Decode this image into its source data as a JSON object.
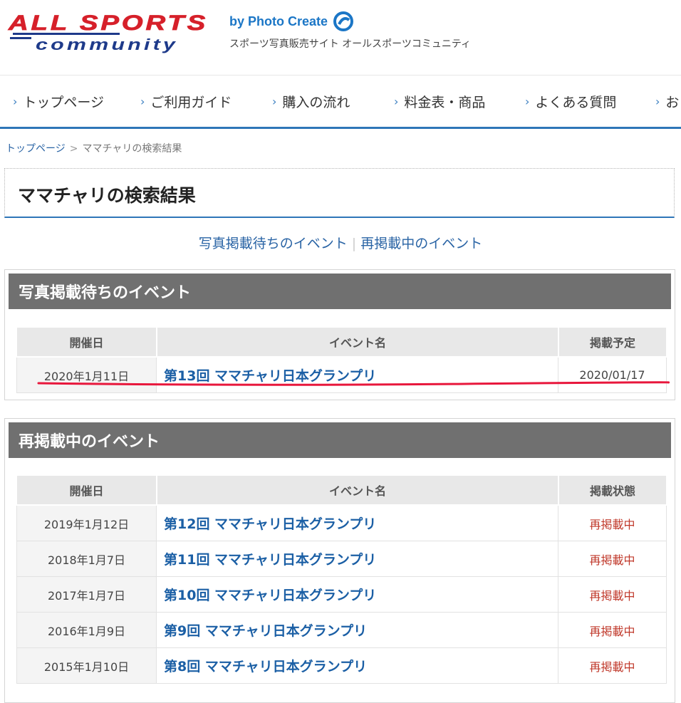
{
  "header": {
    "by_line": "by Photo Create",
    "tagline": "スポーツ写真販売サイト オールスポーツコミュニティ",
    "logo_lines": [
      "ALL SPORTS",
      "community"
    ]
  },
  "nav": {
    "items": [
      {
        "label": "トップページ"
      },
      {
        "label": "ご利用ガイド"
      },
      {
        "label": "購入の流れ"
      },
      {
        "label": "料金表・商品"
      },
      {
        "label": "よくある質問"
      },
      {
        "label": "お"
      }
    ]
  },
  "breadcrumb": {
    "home": "トップページ",
    "separator": ">",
    "current": "ママチャリの検索結果"
  },
  "page_title": "ママチャリの検索結果",
  "anchors": {
    "pending": "写真掲載待ちのイベント",
    "separator": "|",
    "republished": "再掲載中のイベント"
  },
  "pending_section": {
    "title": "写真掲載待ちのイベント",
    "columns": [
      "開催日",
      "イベント名",
      "掲載予定"
    ],
    "rows": [
      {
        "date": "2020年1月11日",
        "name": "第13回 ママチャリ日本グランプリ",
        "status": "2020/01/17"
      }
    ]
  },
  "republished_section": {
    "title": "再掲載中のイベント",
    "columns": [
      "開催日",
      "イベント名",
      "掲載状態"
    ],
    "rows": [
      {
        "date": "2019年1月12日",
        "name": "第12回 ママチャリ日本グランプリ",
        "status": "再掲載中"
      },
      {
        "date": "2018年1月7日",
        "name": "第11回 ママチャリ日本グランプリ",
        "status": "再掲載中"
      },
      {
        "date": "2017年1月7日",
        "name": "第10回 ママチャリ日本グランプリ",
        "status": "再掲載中"
      },
      {
        "date": "2016年1月9日",
        "name": "第9回 ママチャリ日本グランプリ",
        "status": "再掲載中"
      },
      {
        "date": "2015年1月10日",
        "name": "第8回 ママチャリ日本グランプリ",
        "status": "再掲載中"
      }
    ]
  },
  "colors": {
    "accent_blue": "#2e76b8",
    "link_blue": "#1b5fa5",
    "section_header_gray": "#707070",
    "status_red": "#c0392b",
    "highlight_underline": "#e8173c",
    "logo_red": "#d6202a",
    "logo_blue": "#1e3a8a"
  }
}
